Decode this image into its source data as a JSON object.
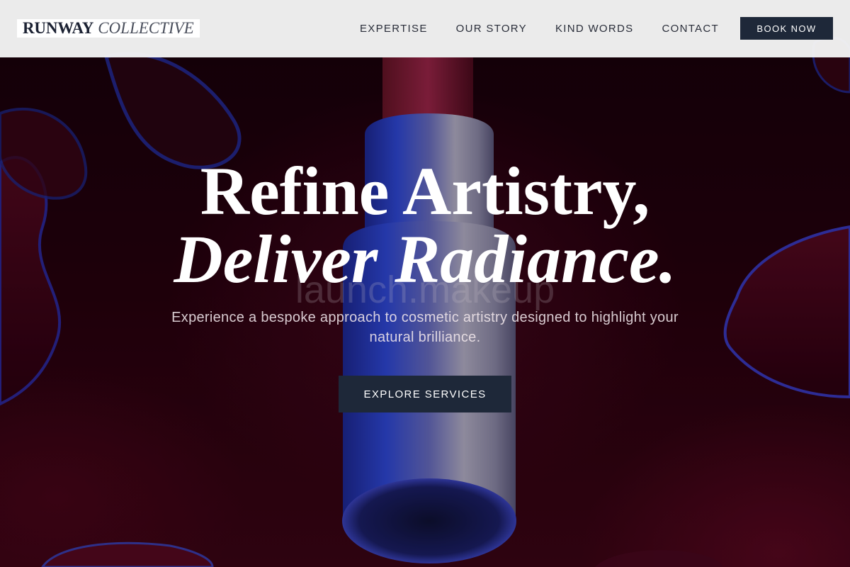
{
  "brand": {
    "name_bold": "RUNWAY",
    "name_italic": "COLLECTIVE"
  },
  "nav": {
    "items": [
      {
        "label": "EXPERTISE"
      },
      {
        "label": "OUR STORY"
      },
      {
        "label": "KIND WORDS"
      },
      {
        "label": "CONTACT"
      }
    ],
    "book_label": "BOOK NOW"
  },
  "hero": {
    "headline_line1": "Refine Artistry,",
    "headline_line2": "Deliver Radiance.",
    "watermark": "launch.makeup",
    "subtext": "Experience a bespoke approach to cosmetic artistry designed to highlight your natural brilliance.",
    "cta_label": "EXPLORE SERVICES"
  },
  "colors": {
    "primary_dark": "#1e2839",
    "nav_background": "#f5f5f5",
    "hero_background": "#22000c"
  }
}
